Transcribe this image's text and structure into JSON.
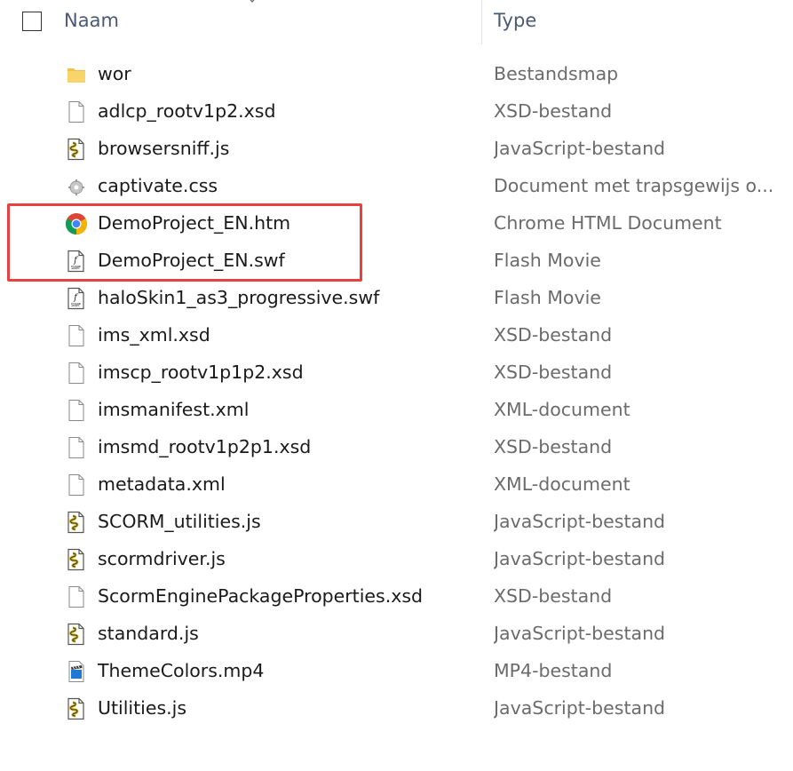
{
  "header": {
    "name_label": "Naam",
    "type_label": "Type"
  },
  "files": [
    {
      "name": "wor",
      "type": "Bestandsmap",
      "icon": "folder-icon"
    },
    {
      "name": "adlcp_rootv1p2.xsd",
      "type": "XSD-bestand",
      "icon": "blank-file-icon"
    },
    {
      "name": "browsersniff.js",
      "type": "JavaScript-bestand",
      "icon": "script-file-icon"
    },
    {
      "name": "captivate.css",
      "type": "Document met trapsgewijs o...",
      "icon": "css-file-icon"
    },
    {
      "name": "DemoProject_EN.htm",
      "type": "Chrome HTML Document",
      "icon": "chrome-icon"
    },
    {
      "name": "DemoProject_EN.swf",
      "type": "Flash Movie",
      "icon": "flash-file-icon"
    },
    {
      "name": "haloSkin1_as3_progressive.swf",
      "type": "Flash Movie",
      "icon": "flash-file-icon"
    },
    {
      "name": "ims_xml.xsd",
      "type": "XSD-bestand",
      "icon": "blank-file-icon"
    },
    {
      "name": "imscp_rootv1p1p2.xsd",
      "type": "XSD-bestand",
      "icon": "blank-file-icon"
    },
    {
      "name": "imsmanifest.xml",
      "type": "XML-document",
      "icon": "blank-file-icon"
    },
    {
      "name": "imsmd_rootv1p2p1.xsd",
      "type": "XSD-bestand",
      "icon": "blank-file-icon"
    },
    {
      "name": "metadata.xml",
      "type": "XML-document",
      "icon": "blank-file-icon"
    },
    {
      "name": "SCORM_utilities.js",
      "type": "JavaScript-bestand",
      "icon": "script-file-icon"
    },
    {
      "name": "scormdriver.js",
      "type": "JavaScript-bestand",
      "icon": "script-file-icon"
    },
    {
      "name": "ScormEnginePackageProperties.xsd",
      "type": "XSD-bestand",
      "icon": "blank-file-icon"
    },
    {
      "name": "standard.js",
      "type": "JavaScript-bestand",
      "icon": "script-file-icon"
    },
    {
      "name": "ThemeColors.mp4",
      "type": "MP4-bestand",
      "icon": "video-file-icon"
    },
    {
      "name": "Utilities.js",
      "type": "JavaScript-bestand",
      "icon": "script-file-icon"
    }
  ],
  "highlight_color": "#e8413f"
}
